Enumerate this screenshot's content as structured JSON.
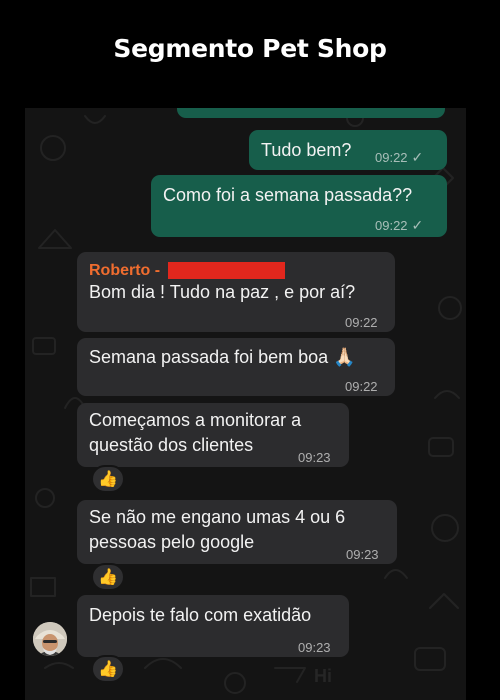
{
  "header": {
    "title": "Segmento Pet Shop"
  },
  "messages": {
    "m1": {
      "text": "Tudo bem?",
      "time": "09:22",
      "status": "read-check-icon"
    },
    "m2": {
      "text": "Como foi a semana passada??",
      "time": "09:22",
      "status": "read-check-icon"
    },
    "m3": {
      "sender": "Roberto -",
      "text": "Bom dia ! Tudo na paz , e por aí?",
      "time": "09:22"
    },
    "m4": {
      "text": "Semana passada foi bem boa",
      "time": "09:22",
      "emoji": "🙏🏻"
    },
    "m5": {
      "line1": "Começamos a monitorar a",
      "line2": "questão dos clientes",
      "time": "09:23",
      "reaction": "👍"
    },
    "m6": {
      "line1": "Se não me engano umas 4 ou 6",
      "line2": "pessoas pelo google",
      "time": "09:23",
      "reaction": "👍"
    },
    "m7": {
      "text": "Depois te falo com exatidão",
      "time": "09:23",
      "reaction": "👍"
    }
  },
  "colors": {
    "outgoing_bubble": "#175e4b",
    "incoming_bubble": "#2c2c2e",
    "sender_name": "#f06d2f",
    "redaction": "#e2271d",
    "chat_background": "#141414"
  }
}
